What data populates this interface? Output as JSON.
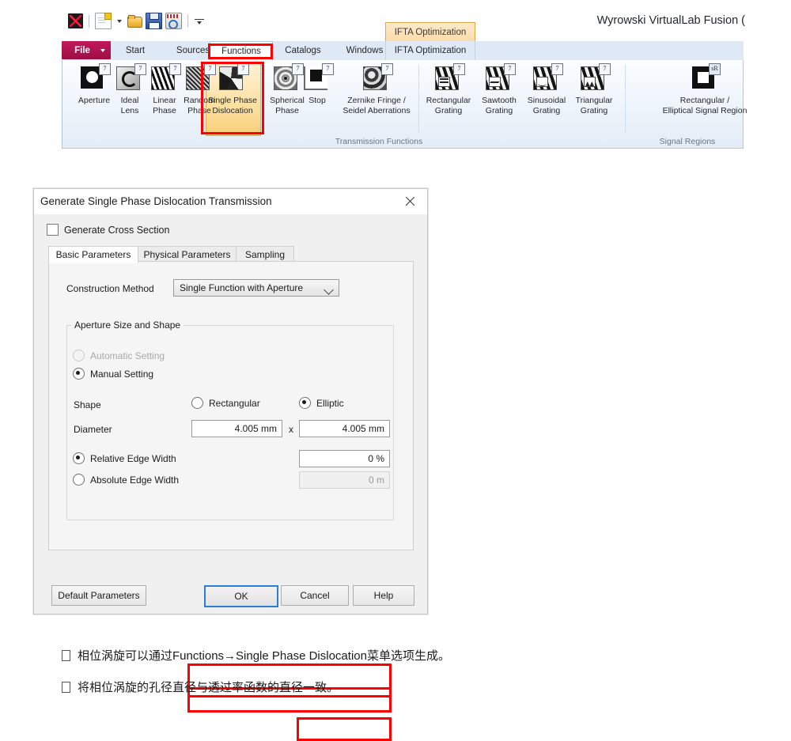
{
  "app": {
    "title": "Wyrowski VirtualLab Fusion (",
    "quick_access": [
      {
        "name": "app-logo-icon",
        "label": "VirtualLab"
      },
      {
        "name": "new-document-icon",
        "label": "New"
      },
      {
        "name": "open-file-icon",
        "label": "Open"
      },
      {
        "name": "save-icon",
        "label": "Save"
      },
      {
        "name": "tools-icon",
        "label": "Tools"
      },
      {
        "name": "customize-toolbar-icon",
        "label": "Customize Quick Access Toolbar"
      }
    ]
  },
  "ribbon": {
    "contextual_tab_label": "IFTA Optimization",
    "tabs": [
      {
        "label": "File",
        "active": false
      },
      {
        "label": "Start",
        "active": false
      },
      {
        "label": "Sources",
        "active": false
      },
      {
        "label": "Functions",
        "active": true
      },
      {
        "label": "Catalogs",
        "active": false
      },
      {
        "label": "Windows",
        "active": false
      },
      {
        "label": "IFTA Optimization",
        "active": false
      }
    ],
    "groups": [
      {
        "label": "Transmission Functions"
      },
      {
        "label": "Signal Regions"
      }
    ],
    "buttons": [
      {
        "label": "Aperture",
        "icon": "aperture-icon",
        "selected": false
      },
      {
        "label": "Ideal\nLens",
        "icon": "ideal-lens-icon",
        "selected": false
      },
      {
        "label": "Linear\nPhase",
        "icon": "linear-phase-icon",
        "selected": false
      },
      {
        "label": "Random\nPhase",
        "icon": "random-phase-icon",
        "selected": false
      },
      {
        "label": "Single Phase\nDislocation",
        "icon": "single-phase-dislocation-icon",
        "selected": true
      },
      {
        "label": "Spherical\nPhase",
        "icon": "spherical-phase-icon",
        "selected": false
      },
      {
        "label": "Stop",
        "icon": "stop-icon",
        "selected": false
      },
      {
        "label": "Zernike Fringe /\nSeidel Aberrations",
        "icon": "zernike-seidel-icon",
        "selected": false
      },
      {
        "label": "Rectangular\nGrating",
        "icon": "rectangular-grating-icon",
        "selected": false
      },
      {
        "label": "Sawtooth\nGrating",
        "icon": "sawtooth-grating-icon",
        "selected": false
      },
      {
        "label": "Sinusoidal\nGrating",
        "icon": "sinusoidal-grating-icon",
        "selected": false
      },
      {
        "label": "Triangular\nGrating",
        "icon": "triangular-grating-icon",
        "selected": false
      },
      {
        "label": "Rectangular /\nElliptical Signal Region",
        "icon": "signal-region-icon",
        "selected": false
      }
    ]
  },
  "dialog": {
    "title": "Generate Single Phase Dislocation Transmission",
    "close_label": "Close",
    "cross_section": {
      "label": "Generate Cross Section",
      "checked": false
    },
    "tabs": [
      {
        "label": "Basic Parameters",
        "active": true
      },
      {
        "label": "Physical Parameters",
        "active": false
      },
      {
        "label": "Sampling",
        "active": false
      }
    ],
    "construction_method": {
      "label": "Construction Method",
      "value": "Single Function with Aperture",
      "options": [
        "Single Function with Aperture"
      ]
    },
    "aperture_group": {
      "title": "Aperture Size and Shape",
      "automatic_setting": {
        "label": "Automatic Setting",
        "selected": false,
        "enabled": false
      },
      "manual_setting": {
        "label": "Manual Setting",
        "selected": true,
        "enabled": true
      },
      "shape": {
        "label": "Shape",
        "rectangular": {
          "label": "Rectangular",
          "selected": false
        },
        "elliptic": {
          "label": "Elliptic",
          "selected": true
        }
      },
      "diameter": {
        "label": "Diameter",
        "x_value": "4.005 mm",
        "separator": "x",
        "y_value": "4.005 mm"
      },
      "relative_edge_width": {
        "label": "Relative Edge Width",
        "selected": true,
        "value": "0 %"
      },
      "absolute_edge_width": {
        "label": "Absolute Edge Width",
        "selected": false,
        "value": "0 m"
      }
    },
    "buttons": [
      {
        "label": "Default Parameters",
        "default": false
      },
      {
        "label": "OK",
        "default": true
      },
      {
        "label": "Cancel",
        "default": false
      },
      {
        "label": "Help",
        "default": false
      }
    ]
  },
  "notes": [
    "相位涡旋可以通过Functions→Single Phase Dislocation菜单选项生成。",
    "将相位涡旋的孔径直径与透过率函数的直径一致。"
  ],
  "colors": {
    "highlight_red": "#ff0000",
    "ribbon_selected": "#fbdcab",
    "file_tab": "#c2185b",
    "default_button_border": "#2a7fd4"
  }
}
